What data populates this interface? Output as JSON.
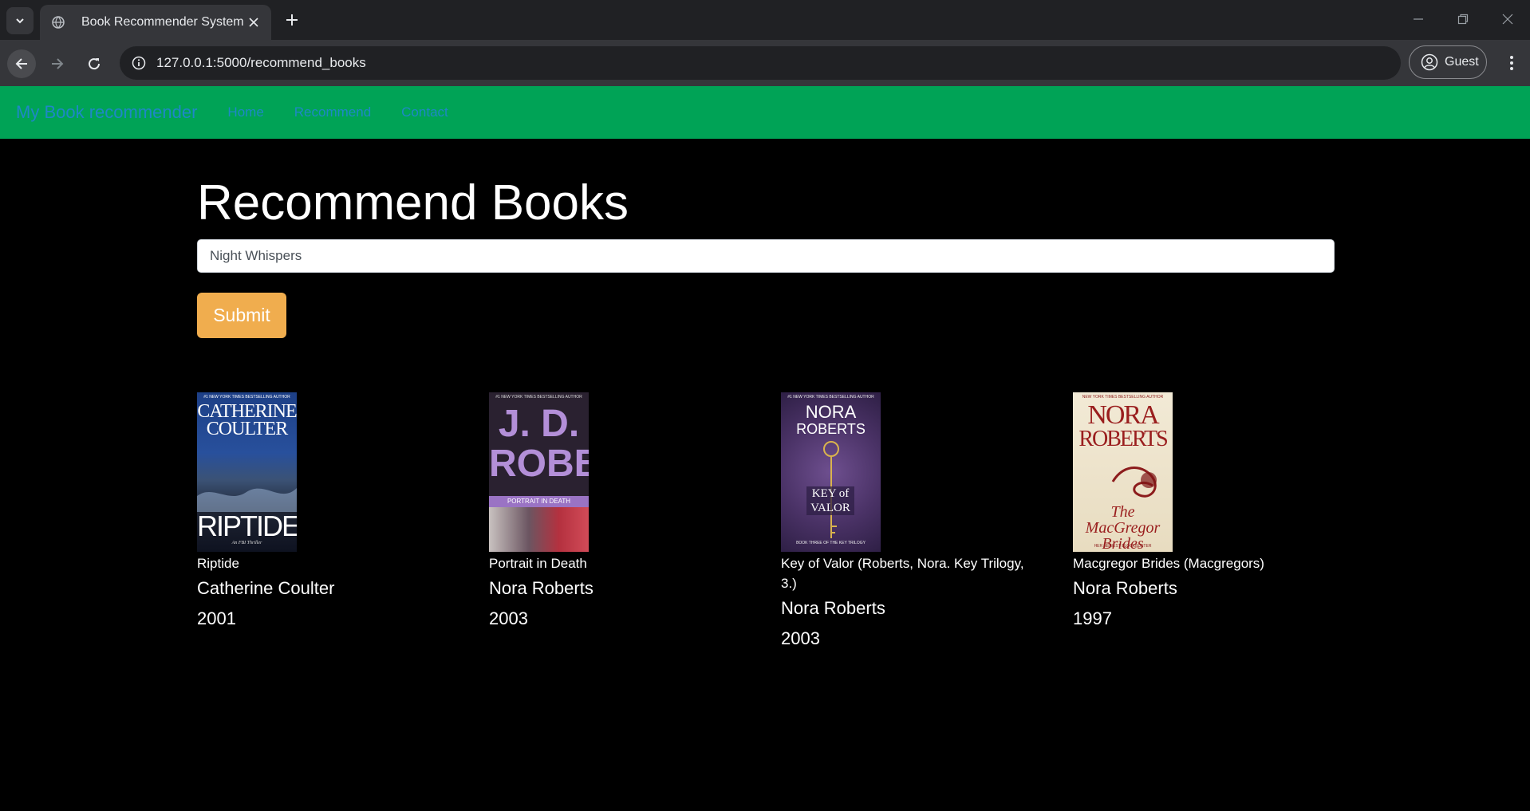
{
  "browser": {
    "tab_title": "Book Recommender System",
    "url": "127.0.0.1:5000/recommend_books",
    "profile_label": "Guest"
  },
  "navbar": {
    "brand": "My Book recommender",
    "links": [
      "Home",
      "Recommend",
      "Contact"
    ]
  },
  "page": {
    "heading": "Recommend Books",
    "search_value": "Night Whispers",
    "submit_label": "Submit"
  },
  "books": [
    {
      "title": "Riptide",
      "author": "Catherine Coulter",
      "year": "2001",
      "cover": {
        "top": "#1 NEW YORK TIMES BESTSELLING AUTHOR",
        "line1": "CATHERINE",
        "line2": "COULTER",
        "main": "RIPTIDE",
        "sub": "An FBI Thriller"
      }
    },
    {
      "title": "Portrait in Death",
      "author": "Nora Roberts",
      "year": "2003",
      "cover": {
        "top": "#1 NEW YORK TIMES BESTSELLING AUTHOR",
        "line1": "J. D.",
        "line2": "ROBB",
        "main": "PORTRAIT IN DEATH"
      }
    },
    {
      "title": "Key of Valor (Roberts, Nora. Key Trilogy, 3.)",
      "author": "Nora Roberts",
      "year": "2003",
      "cover": {
        "top": "#1 NEW YORK TIMES BESTSELLING AUTHOR",
        "line1": "NORA",
        "line2": "ROBERTS",
        "main": "KEY of VALOR",
        "sub": "BOOK THREE OF THE KEY TRILOGY"
      }
    },
    {
      "title": "Macgregor Brides (Macgregors)",
      "author": "Nora Roberts",
      "year": "1997",
      "cover": {
        "top": "NEW YORK TIMES BESTSELLING AUTHOR",
        "line1": "NORA",
        "line2": "ROBERTS",
        "main": "The MacGregor Brides",
        "sub": "HER NEWEST BLOCKBUSTER"
      }
    }
  ],
  "colors": {
    "navbar": "#00a356",
    "nav_link": "#1e88c7",
    "submit": "#f0ad4e",
    "background": "#000000"
  }
}
